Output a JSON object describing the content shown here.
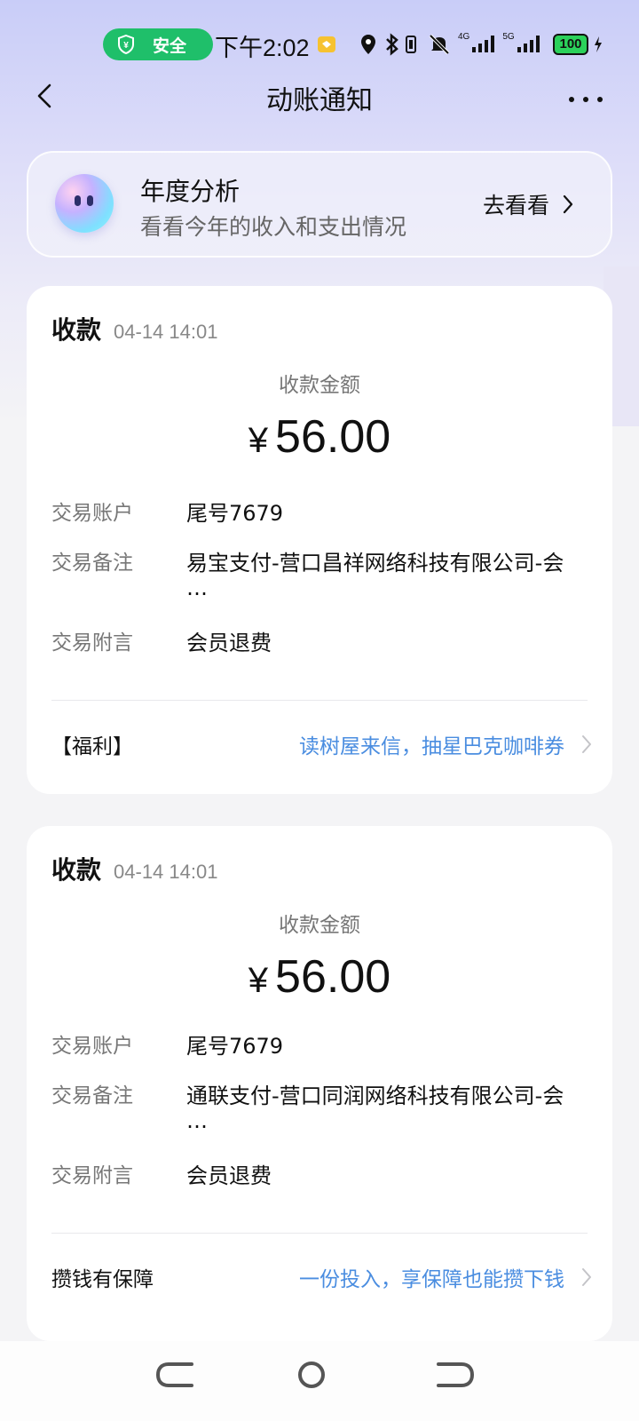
{
  "status_bar": {
    "safe_label": "安全",
    "time": "下午2:02",
    "network_4g": "4G",
    "network_5g": "5G",
    "battery": "100"
  },
  "nav": {
    "title": "动账通知"
  },
  "annual": {
    "title": "年度分析",
    "subtitle": "看看今年的收入和支出情况",
    "action": "去看看"
  },
  "cards": [
    {
      "type": "收款",
      "time": "04-14 14:01",
      "amount_label": "收款金额",
      "currency": "¥",
      "amount": "56.00",
      "rows": [
        {
          "label": "交易账户",
          "value": "尾号7679"
        },
        {
          "label": "交易备注",
          "value": "易宝支付-营口昌祥网络科技有限公司-会",
          "value_more": "…"
        },
        {
          "label": "交易附言",
          "value": "会员退费"
        }
      ],
      "promo_label": "【福利】",
      "promo_link": "读树屋来信，抽星巴克咖啡券"
    },
    {
      "type": "收款",
      "time": "04-14 14:01",
      "amount_label": "收款金额",
      "currency": "¥",
      "amount": "56.00",
      "rows": [
        {
          "label": "交易账户",
          "value": "尾号7679"
        },
        {
          "label": "交易备注",
          "value": "通联支付-营口同润网络科技有限公司-会",
          "value_more": "…"
        },
        {
          "label": "交易附言",
          "value": "会员退费"
        }
      ],
      "promo_label": "攒钱有保障",
      "promo_link": "一份投入，享保障也能攒下钱"
    }
  ],
  "colors": {
    "safe_green": "#1fbf6a",
    "link_blue": "#4a8de0",
    "battery_green": "#2bd15b"
  },
  "icons": [
    "shield-icon",
    "location-icon",
    "bluetooth-icon",
    "mute-icon",
    "signal-icon",
    "back-icon",
    "more-icon",
    "chevron-right-icon"
  ]
}
